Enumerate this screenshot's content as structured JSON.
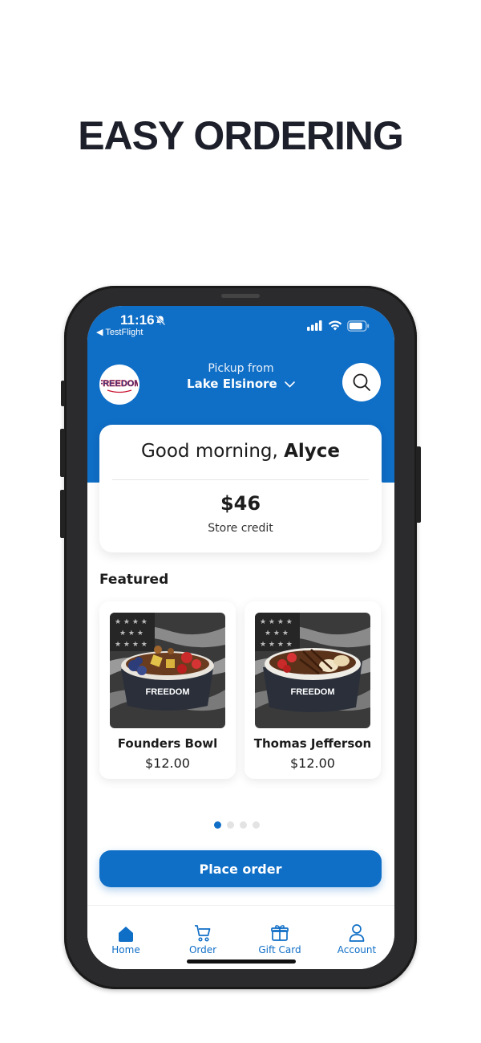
{
  "headline": "EASY ORDERING",
  "status_bar": {
    "time": "11:16",
    "back_app": "◀ TestFlight"
  },
  "header": {
    "logo_text": "FREEDOM",
    "pickup_label": "Pickup from",
    "pickup_location": "Lake Elsinore"
  },
  "greeting": {
    "prefix": "Good morning, ",
    "name": "Alyce",
    "credit_amount": "$46",
    "credit_label": "Store credit"
  },
  "featured": {
    "title": "Featured",
    "items": [
      {
        "name": "Founders Bowl",
        "price": "$12.00",
        "bowl_logo": "FREEDOM"
      },
      {
        "name": "Thomas Jefferson",
        "price": "$12.00",
        "bowl_logo": "FREEDOM"
      }
    ],
    "page_count": 4,
    "active_page": 0
  },
  "place_order_label": "Place order",
  "tabs": [
    {
      "label": "Home",
      "icon": "home-icon"
    },
    {
      "label": "Order",
      "icon": "cart-icon"
    },
    {
      "label": "Gift Card",
      "icon": "gift-icon"
    },
    {
      "label": "Account",
      "icon": "person-icon"
    }
  ],
  "colors": {
    "brand_blue": "#0f6ec6",
    "headline": "#1d1f2a",
    "phone_frame": "#2b2b2d"
  }
}
